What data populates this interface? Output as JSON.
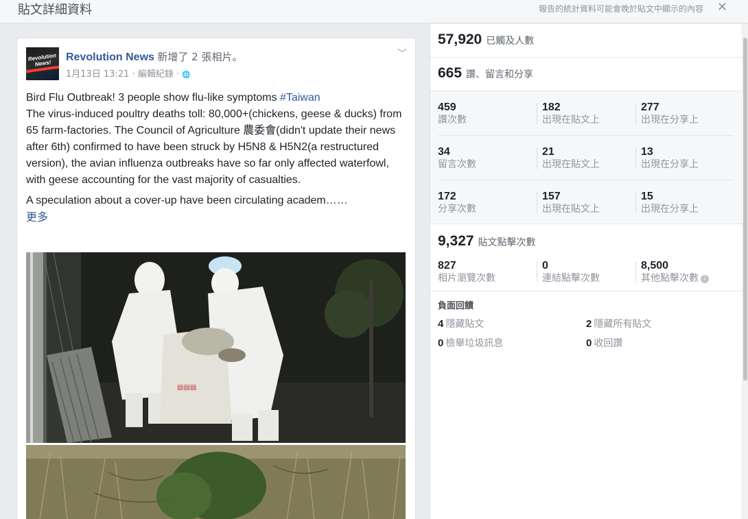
{
  "header": {
    "title": "貼文詳細資料",
    "note": "報告的統計資料可能會晚於貼文中顯示的內容",
    "close": "✕"
  },
  "post": {
    "author": "Revolution News",
    "action": "新增了 2 張相片。",
    "avatar_text": "Revolution News!",
    "date": "1月13日 13:21",
    "edit_history": "編輯紀錄",
    "separator": "·",
    "globe": "🌐",
    "chevron": "﹀",
    "line1_text": "Bird Flu Outbreak! 3 people show flu-like symptoms ",
    "hashtag": "#Taiwan",
    "paragraph": "The virus-induced poultry deaths toll: 80,000+(chickens, geese & ducks) from 65 farm-factories. The Council of Agriculture 農委會(didn't update their news after 6th) confirmed to have been struck by H5N8 & H5N2(a restructured version), the avian influenza outbreaks have so far only affected waterfowl, with geese accounting for the vast majority of casualties.",
    "speculation": "A speculation about a cover-up have been circulating academ……",
    "more": "更多"
  },
  "stats": {
    "reach": {
      "value": "57,920",
      "label": "已觸及人數"
    },
    "engagement": {
      "value": "665",
      "label": "讚、留言和分享"
    },
    "grid": [
      [
        {
          "value": "459",
          "label": "讚次數"
        },
        {
          "value": "182",
          "label": "出現在貼文上"
        },
        {
          "value": "277",
          "label": "出現在分享上"
        }
      ],
      [
        {
          "value": "34",
          "label": "留言次數"
        },
        {
          "value": "21",
          "label": "出現在貼文上"
        },
        {
          "value": "13",
          "label": "出現在分享上"
        }
      ],
      [
        {
          "value": "172",
          "label": "分享次數"
        },
        {
          "value": "157",
          "label": "出現在貼文上"
        },
        {
          "value": "15",
          "label": "出現在分享上"
        }
      ]
    ],
    "clicks": {
      "value": "9,327",
      "label": "貼文點擊次數"
    },
    "clicks_detail": [
      {
        "value": "827",
        "label": "相片瀏覽次數"
      },
      {
        "value": "0",
        "label": "連結點擊次數"
      },
      {
        "value": "8,500",
        "label": "其他點擊次數"
      }
    ],
    "info_icon": "i",
    "negative": {
      "title": "負面回饋",
      "items": [
        {
          "value": "4",
          "label": "隱藏貼文"
        },
        {
          "value": "2",
          "label": "隱藏所有貼文"
        },
        {
          "value": "0",
          "label": "檢舉垃圾訊息"
        },
        {
          "value": "0",
          "label": "收回讚"
        }
      ]
    }
  }
}
